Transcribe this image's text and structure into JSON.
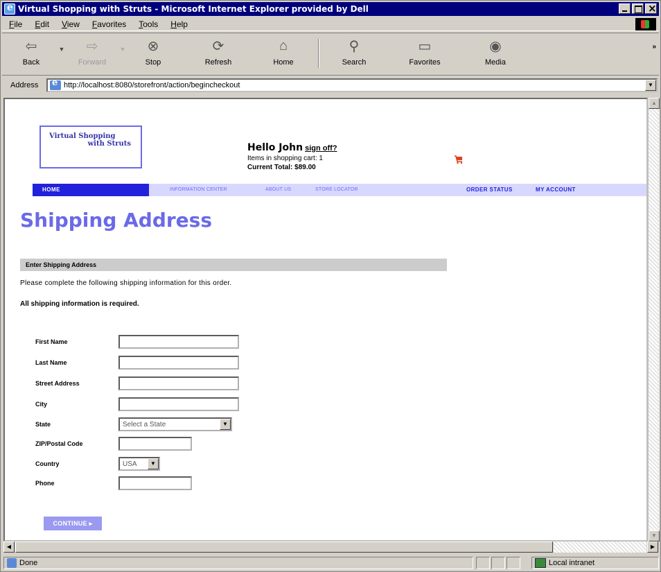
{
  "window": {
    "title": "Virtual Shopping with Struts - Microsoft Internet Explorer provided by Dell"
  },
  "menu": [
    "File",
    "Edit",
    "View",
    "Favorites",
    "Tools",
    "Help"
  ],
  "toolbar": {
    "back": "Back",
    "forward": "Forward",
    "stop": "Stop",
    "refresh": "Refresh",
    "home": "Home",
    "search": "Search",
    "favorites": "Favorites",
    "media": "Media",
    "more": "»"
  },
  "address": {
    "label": "Address",
    "url": "http://localhost:8080/storefront/action/begincheckout"
  },
  "status": {
    "text": "Done",
    "zone": "Local intranet"
  },
  "page": {
    "logo": {
      "line1": "Virtual Shopping",
      "line2": "with Struts"
    },
    "greeting": {
      "hello": "Hello John",
      "signoff": "sign off?",
      "cart_label": "Items in shopping cart:",
      "cart_count": "1",
      "total_label": "Current Total:",
      "total_value": "$89.00"
    },
    "nav": {
      "home": "HOME",
      "info": "INFORMATION CENTER",
      "about": "ABOUT US",
      "locator": "STORE LOCATOR",
      "order_status": "ORDER STATUS",
      "account": "MY ACCOUNT"
    },
    "heading": "Shipping Address",
    "section_title": "Enter Shipping Address",
    "intro": "Please complete the following shipping information for this order.",
    "required_note": "All shipping information is required.",
    "form": {
      "first_name": {
        "label": "First Name",
        "value": ""
      },
      "last_name": {
        "label": "Last Name",
        "value": ""
      },
      "street": {
        "label": "Street Address",
        "value": ""
      },
      "city": {
        "label": "City",
        "value": ""
      },
      "state": {
        "label": "State",
        "selected": "Select a State"
      },
      "zip": {
        "label": "ZIP/Postal Code",
        "value": ""
      },
      "country": {
        "label": "Country",
        "selected": "USA"
      },
      "phone": {
        "label": "Phone",
        "value": ""
      }
    },
    "continue_label": "CONTINUE ▸"
  },
  "colors": {
    "title_bar": "#00007c",
    "brand_blue": "#6a6ae8",
    "nav_bg": "#d8d8ff",
    "nav_home": "#2222dd",
    "section_bar": "#cccccc",
    "continue_btn": "#9a9af0"
  },
  "icons": {
    "app": "ie-logo-icon",
    "back": "back-arrow-icon",
    "forward": "forward-arrow-icon",
    "stop": "stop-icon",
    "refresh": "refresh-icon",
    "home": "home-icon",
    "search": "search-icon",
    "favorites": "favorites-icon",
    "media": "media-icon",
    "cart": "shopping-cart-icon"
  }
}
